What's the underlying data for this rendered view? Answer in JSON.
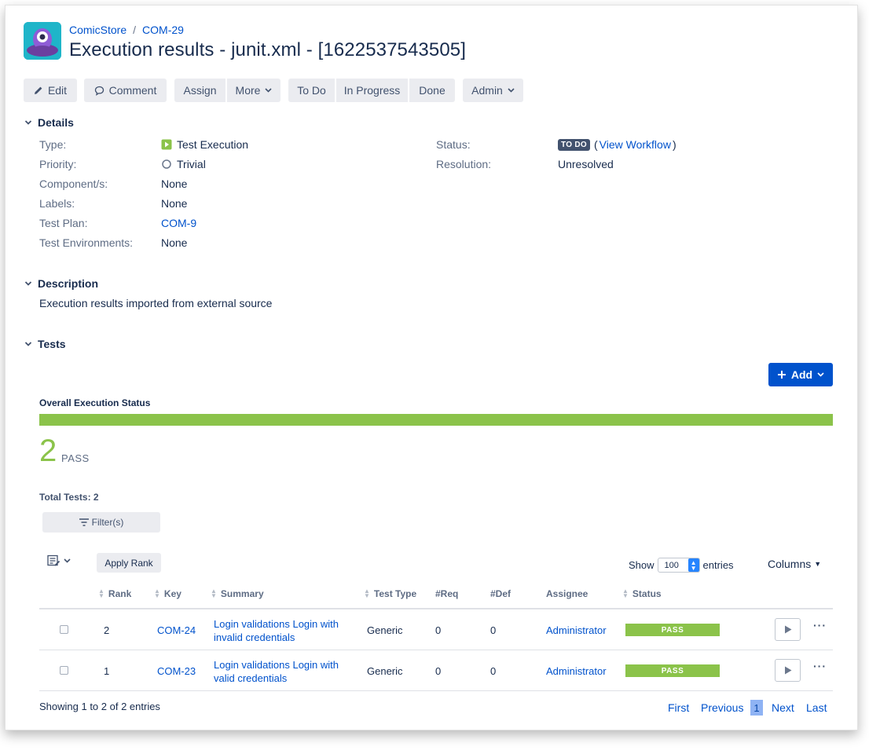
{
  "header": {
    "project": "ComicStore",
    "separator": "/",
    "issue_key": "COM-29",
    "title": "Execution results - junit.xml - [1622537543505]"
  },
  "toolbar": {
    "edit": "Edit",
    "comment": "Comment",
    "assign": "Assign",
    "more": "More",
    "todo": "To Do",
    "in_progress": "In Progress",
    "done": "Done",
    "admin": "Admin"
  },
  "details": {
    "heading": "Details",
    "type_label": "Type:",
    "type_value": "Test Execution",
    "priority_label": "Priority:",
    "priority_value": "Trivial",
    "components_label": "Component/s:",
    "components_value": "None",
    "labels_label": "Labels:",
    "labels_value": "None",
    "test_plan_label": "Test Plan:",
    "test_plan_value": "COM-9",
    "test_env_label": "Test Environments:",
    "test_env_value": "None",
    "status_label": "Status:",
    "status_value": "TO DO",
    "view_workflow_open": "(",
    "view_workflow": "View Workflow",
    "view_workflow_close": ")",
    "resolution_label": "Resolution:",
    "resolution_value": "Unresolved"
  },
  "description": {
    "heading": "Description",
    "text": "Execution results imported from external source"
  },
  "tests": {
    "heading": "Tests",
    "add_label": "Add",
    "overall_label": "Overall Execution Status",
    "pass_fraction": 1.0,
    "pass_count": "2",
    "pass_word": "PASS",
    "total_tests": "Total Tests: 2",
    "filter_label": "Filter(s)",
    "apply_rank": "Apply Rank",
    "show_label": "Show",
    "entries_value": "100",
    "entries_label": "entries",
    "columns_label": "Columns",
    "columns": [
      "Rank",
      "Key",
      "Summary",
      "Test Type",
      "#Req",
      "#Def",
      "Assignee",
      "Status"
    ],
    "rows": [
      {
        "rank": "2",
        "key": "COM-24",
        "summary_line1": "Login validations Login with",
        "summary_line2": "invalid credentials",
        "test_type": "Generic",
        "req": "0",
        "def": "0",
        "assignee": "Administrator",
        "status": "PASS"
      },
      {
        "rank": "1",
        "key": "COM-23",
        "summary_line1": "Login validations Login with",
        "summary_line2": "valid credentials",
        "test_type": "Generic",
        "req": "0",
        "def": "0",
        "assignee": "Administrator",
        "status": "PASS"
      }
    ],
    "showing": "Showing 1 to 2 of 2 entries",
    "pager": {
      "first": "First",
      "previous": "Previous",
      "current": "1",
      "next": "Next",
      "last": "Last"
    }
  },
  "colors": {
    "link": "#0052cc",
    "pass": "#8bc34a",
    "primary": "#0052cc",
    "lozenge": "#42526e"
  }
}
